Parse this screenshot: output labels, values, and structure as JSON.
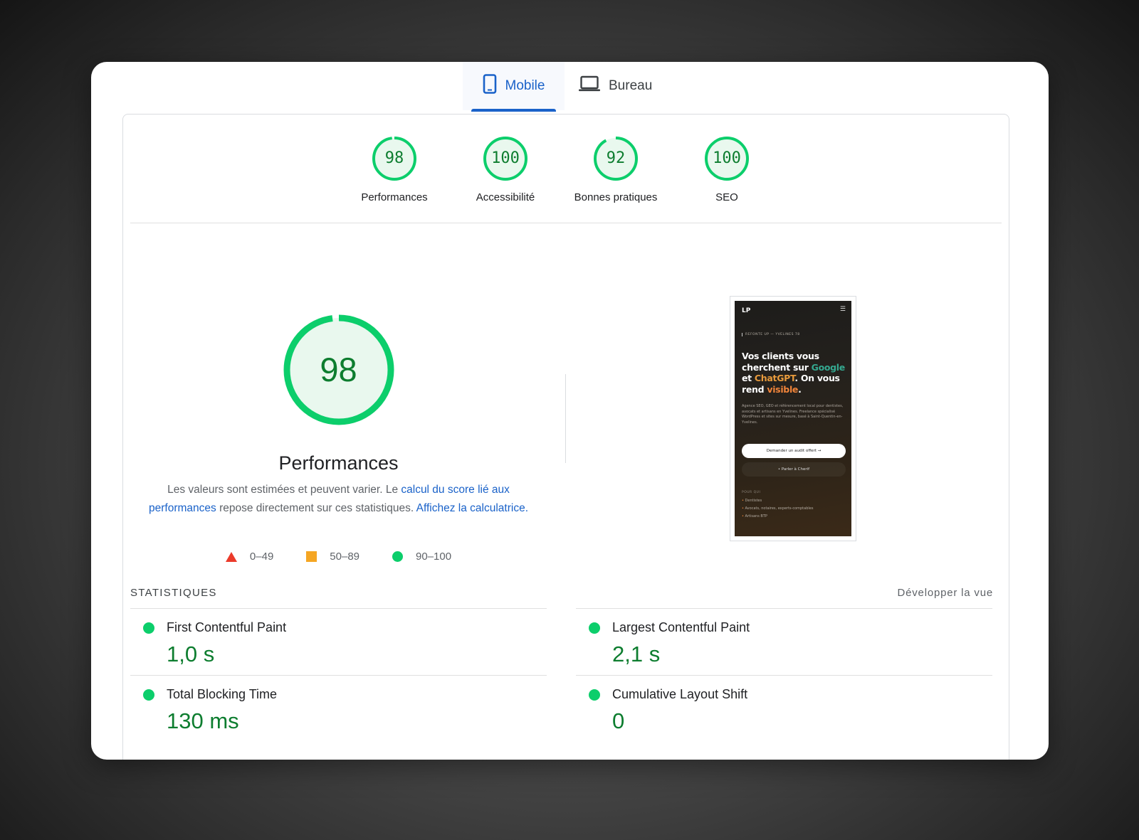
{
  "tabs": {
    "mobile": "Mobile",
    "desktop": "Bureau"
  },
  "gauges": [
    {
      "score": "98",
      "label": "Performances",
      "value": 98
    },
    {
      "score": "100",
      "label": "Accessibilité",
      "value": 100
    },
    {
      "score": "92",
      "label": "Bonnes pratiques",
      "value": 92
    },
    {
      "score": "100",
      "label": "SEO",
      "value": 100
    }
  ],
  "performance": {
    "score": "98",
    "value": 98,
    "title": "Performances",
    "desc_1": "Les valeurs sont estimées et peuvent varier. Le ",
    "link_1": "calcul du score lié aux performances",
    "desc_2": " repose directement sur ces statistiques. ",
    "link_2": "Affichez la calculatrice."
  },
  "legend": {
    "fail": "0–49",
    "average": "50–89",
    "pass": "90–100"
  },
  "screenshot": {
    "logo": "LP",
    "kicker": "REFONTE UP — YVELINES 78",
    "h_1": "Vos clients vous cherchent sur ",
    "h_google": "Google",
    "h_et": " et ",
    "h_chatgpt": "ChatGPT",
    "h_2": ". On vous rend ",
    "h_visible": "visible",
    "h_3": ".",
    "copy": "Agence SEO, GEO et référencement local pour dentistes, avocats et artisans en Yvelines. Freelance spécialisé WordPress et sites sur mesure, basé à Saint-Quentin-en-Yvelines.",
    "cta_primary": "Demander un audit offert →",
    "cta_secondary": "• Parler à Cherif",
    "pour_qui": "POUR QUI",
    "list": [
      "Dentistes",
      "Avocats, notaires, experts-comptables",
      "Artisans BTP"
    ]
  },
  "stats": {
    "heading": "STATISTIQUES",
    "expand": "Développer la vue",
    "metrics": [
      {
        "name": "First Contentful Paint",
        "value": "1,0 s"
      },
      {
        "name": "Largest Contentful Paint",
        "value": "2,1 s"
      },
      {
        "name": "Total Blocking Time",
        "value": "130 ms"
      },
      {
        "name": "Cumulative Layout Shift",
        "value": "0"
      }
    ]
  },
  "colors": {
    "pass": "#0cce6b",
    "pass_text": "#0d7d2f",
    "average": "#f5a623",
    "fail": "#eb3a2a",
    "link": "#1a62c9"
  }
}
